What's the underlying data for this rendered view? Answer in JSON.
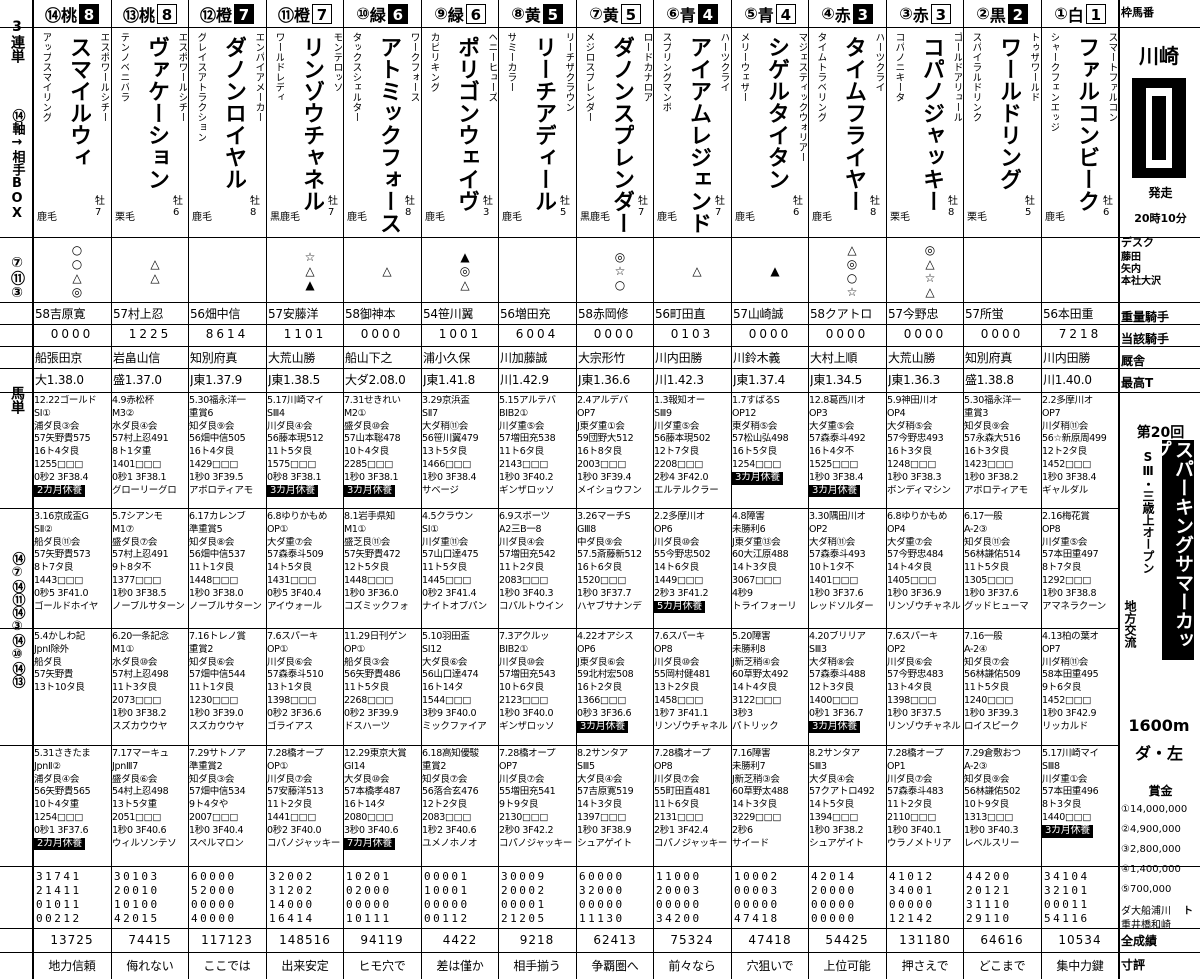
{
  "left_column": {
    "top_label": "3連単",
    "axis": "⑭軸→相手BOX",
    "nums1": [
      "⑦",
      "⑪",
      "③"
    ],
    "grid_nums": [
      "④",
      "⑦",
      "⑩",
      "⑬"
    ],
    "umatan": "馬単",
    "nums2": [
      "⑭",
      "⑦",
      "⑭",
      "⑪",
      "⑭",
      "③",
      "⑭",
      "⑩",
      "⑭",
      "⑬"
    ]
  },
  "race": {
    "venue": "川崎",
    "start_label": "発走",
    "start_time": "20時10分",
    "desk_label": "デスク",
    "reporters": [
      "藤田",
      "矢内",
      "本社大沢"
    ],
    "row_labels": [
      "重量騎手",
      "当該騎手",
      "厩舎",
      "最高T"
    ],
    "race_number_title": "第20回",
    "race_title": "スパーキングサマーカップ",
    "race_sub": "SⅢ・三歳上オープン",
    "race_type": "地方交流",
    "distance": "1600m",
    "course": "ダ・左",
    "prize_label": "賞金",
    "prizes": [
      "①14,000,000",
      "②4,900,000",
      "③2,800,000",
      "④1,400,000",
      "⑤700,000"
    ],
    "bottom_labels": [
      "ダ大船浦川",
      "重井橋和崎",
      "全成績",
      "寸評"
    ],
    "header_label": "枠馬番",
    "trainers_label": "ト"
  },
  "horses": [
    {
      "num": "①",
      "waku": "1",
      "color": "白",
      "name": "ファルコンビーク",
      "sire": "スマートファルコン",
      "dam": "シャークフェンエッジ",
      "sex": "牡6",
      "coat": "鹿毛",
      "marks": "",
      "weight_jockey": "56本田重",
      "jockey_count": "7218",
      "stable": "川内田勝",
      "best_time": "川1.40.0",
      "races": [
        [
          "2.2多摩川オ",
          "OP7",
          "川ダ稍⑪会",
          "56☆新原周499",
          "12ト2タ良",
          "1452□□□",
          "1秒0 3F38.4",
          "ギャルダル"
        ],
        [
          "2.16梅花賞",
          "OP8",
          "川ダ重⑤会",
          "57本田重497",
          "8ト7タ良",
          "1292□□□",
          "1秒0 3F38.8",
          "アマネラクーン"
        ],
        [
          "4.13柏の葉オ",
          "OP7",
          "川ダ稍⑪会",
          "58本田重495",
          "9ト6タ良",
          "1452□□□",
          "1秒0 3F42.9",
          "リッカルド"
        ],
        [
          "5.17川崎マイ",
          "SⅢ8",
          "川ダ重①会",
          "57本田重496",
          "8ト3タ良",
          "1440□□□",
          "3カ月休養",
          ""
        ]
      ],
      "stats": [
        "34104",
        "32101",
        "00011",
        "54116"
      ],
      "total": "10534",
      "comment": "集中力鍵",
      "tag": "3カ月休養"
    },
    {
      "num": "②",
      "waku": "2",
      "color": "黒",
      "name": "ワールドリング",
      "sire": "トゥザワールド",
      "dam": "スパイラルドリンク",
      "sex": "牡5",
      "coat": "栗毛",
      "marks": "",
      "weight_jockey": "57所蛍",
      "jockey_count": "0000",
      "stable": "知別府真",
      "best_time": "盛1.38.8",
      "races": [
        [
          "5.30福永洋一",
          "重賞3",
          "知ダ良⑨会",
          "57永森大516",
          "16ト3タ良",
          "1423□□□",
          "1秒0 3F38.2",
          "アポロティアモ"
        ],
        [
          "6.17一般",
          "A-2③",
          "知ダ良⑪会",
          "56林謙佑514",
          "11ト5タ良",
          "1305□□□",
          "1秒0 3F37.6",
          "グッドヒューマ"
        ],
        [
          "7.16一般",
          "A-2④",
          "知ダ良⑦会",
          "56林謙佑509",
          "11ト5タ良",
          "1240□□□",
          "1秒0 3F39.3",
          "ロイスピーク"
        ],
        [
          "7.29倉敷おつ",
          "A-2③",
          "知ダ良⑨会",
          "56林謙佑502",
          "10ト9タ良",
          "1313□□□",
          "1秒0 3F40.3",
          "レベルスリー"
        ]
      ],
      "stats": [
        "44200",
        "20121",
        "31110",
        "29110"
      ],
      "total": "64616",
      "comment": "どこまで",
      "tag": ""
    },
    {
      "num": "③",
      "waku": "3",
      "color": "赤",
      "name": "コパノジャッキー",
      "sire": "ゴールドアリュール",
      "dam": "コパノニキータ",
      "sex": "牡8",
      "coat": "栗毛",
      "marks": "◎△☆△",
      "weight_jockey": "57今野忠",
      "jockey_count": "0000",
      "stable": "大荒山勝",
      "best_time": "J東1.36.3",
      "races": [
        [
          "5.9神田川オ",
          "OP4",
          "大ダ稍⑤会",
          "57今野忠493",
          "16ト3タ良",
          "1248□□□",
          "1秒0 3F38.3",
          "ボンディマシン"
        ],
        [
          "6.8ゆりかもめ",
          "OP4",
          "大ダ重⑦会",
          "57今野忠484",
          "14ト4タ良",
          "1405□□□",
          "1秒0 3F36.9",
          "リンゾウチャネル"
        ],
        [
          "7.6スパーキ",
          "OP2",
          "川ダ良⑥会",
          "57今野忠483",
          "13ト4タ良",
          "1398□□□",
          "1秒0 3F37.5",
          "リンゾウチャネル"
        ],
        [
          "7.28橋オープ",
          "OP1",
          "川ダ良⑦会",
          "57森泰斗483",
          "11ト2タ良",
          "2110□□□",
          "1秒0 3F40.1",
          "ウラノメトリア"
        ]
      ],
      "stats": [
        "41012",
        "34001",
        "00000",
        "12142"
      ],
      "total": "131180",
      "comment": "押さえで",
      "tag": ""
    },
    {
      "num": "④",
      "waku": "3",
      "color": "赤",
      "name": "タイムフライヤー",
      "sire": "ハーツクライ",
      "dam": "タイムトラベリング",
      "sex": "牡8",
      "coat": "鹿毛",
      "marks": "△◎○☆",
      "weight_jockey": "58クアトロ",
      "jockey_count": "0000",
      "stable": "大村上順",
      "best_time": "J東1.34.5",
      "races": [
        [
          "12.8葛西川オ",
          "OP3",
          "大ダ重⑤会",
          "57森泰斗492",
          "16ト4タ不",
          "1525□□□",
          "1秒0 3F38.4",
          "3カ月休養"
        ],
        [
          "3.30隅田川オ",
          "OP2",
          "大ダ稍⑪会",
          "57森泰斗493",
          "10ト1タ不",
          "1401□□□",
          "1秒0 3F37.6",
          "レッドソルダー"
        ],
        [
          "4.20ブリリア",
          "SⅢ3",
          "大ダ稍⑧会",
          "57森泰斗488",
          "12ト3タ良",
          "1400□□□",
          "0秒1 3F36.7",
          "3カ月休養"
        ],
        [
          "8.2サンタア",
          "SⅢ3",
          "大ダ良④会",
          "57クアトロ492",
          "14ト5タ良",
          "1394□□□",
          "1秒0 3F38.2",
          "シュアゲイト"
        ]
      ],
      "stats": [
        "42014",
        "20000",
        "00000",
        "00000"
      ],
      "total": "54425",
      "comment": "上位可能",
      "tag": ""
    },
    {
      "num": "⑤",
      "waku": "4",
      "color": "青",
      "name": "シゲルタイタン",
      "sire": "マジェスティックウォリアー",
      "dam": "メリーウェザー",
      "sex": "牡6",
      "coat": "鹿毛",
      "marks": "▲",
      "weight_jockey": "57山崎誠",
      "jockey_count": "0000",
      "stable": "川鈴木義",
      "best_time": "J東1.37.4",
      "races": [
        [
          "1.7すばるS",
          "OP12",
          "東ダ稍⑤会",
          "57松山弘498",
          "16ト5タ良",
          "1254□□□",
          "3カ月休養",
          ""
        ],
        [
          "4.8障害",
          "未勝利6",
          "J東ダ重⑬会",
          "60大江原488",
          "14ト3タ良",
          "3067□□□",
          "4秒9",
          "トライフォーリ"
        ],
        [
          "5.20障害",
          "未勝利8",
          "J新芝稍④会",
          "60草野太492",
          "14ト4タ良",
          "3122□□□",
          "3秒3",
          "パトリック"
        ],
        [
          "7.16障害",
          "未勝利7",
          "J新芝稍③会",
          "60草野太488",
          "14ト3タ良",
          "3229□□□",
          "2秒6",
          "サイード"
        ]
      ],
      "stats": [
        "10002",
        "00003",
        "00000",
        "47418"
      ],
      "total": "47418",
      "comment": "穴狙いで",
      "tag": "3カ月休養"
    },
    {
      "num": "⑥",
      "waku": "4",
      "color": "青",
      "name": "アイアムレジェンド",
      "sire": "ハーツクライ",
      "dam": "スプリングマンボ",
      "sex": "牡7",
      "coat": "鹿毛",
      "marks": "△",
      "weight_jockey": "56町田直",
      "jockey_count": "0103",
      "stable": "川内田勝",
      "best_time": "川1.42.3",
      "races": [
        [
          "1.3報知オー",
          "SⅢ9",
          "川ダ重⑤会",
          "56藤本現502",
          "12ト7タ良",
          "2208□□□",
          "2秒4 3F42.0",
          "エルテルクラー"
        ],
        [
          "2.2多摩川オ",
          "OP6",
          "川ダ良⑩会",
          "55今野忠502",
          "14ト6タ良",
          "1449□□□",
          "2秒3 3F41.2",
          "5カ月休養"
        ],
        [
          "7.6スパーキ",
          "OP8",
          "川ダ良⑩会",
          "55岡村健481",
          "13ト2タ良",
          "1458□□□",
          "1秒7 3F41.1",
          "リンゾウチャネル"
        ],
        [
          "7.28橋オープ",
          "OP8",
          "川ダ良⑦会",
          "55町田直481",
          "11ト6タ良",
          "2131□□□",
          "2秒1 3F42.4",
          "コパノジャッキー"
        ]
      ],
      "stats": [
        "11000",
        "20003",
        "00000",
        "34200"
      ],
      "total": "75324",
      "comment": "前々なら",
      "tag": "5カ月休養"
    },
    {
      "num": "⑦",
      "waku": "5",
      "color": "黄",
      "name": "ダノンスプレンダー",
      "sire": "ロードカナロア",
      "dam": "メジロスプレンダー",
      "sex": "牡7",
      "coat": "黒鹿毛",
      "marks": "◎☆○",
      "weight_jockey": "58赤岡修",
      "jockey_count": "0000",
      "stable": "大宗形竹",
      "best_time": "J東1.36.6",
      "races": [
        [
          "2.4アルデバ",
          "OP7",
          "J東ダ重①会",
          "59団野大512",
          "16ト8タ良",
          "2003□□□",
          "1秒0 3F39.4",
          "メイショウフン"
        ],
        [
          "3.26マーチS",
          "GⅢ8",
          "中ダ良⑨会",
          "57.5斎藤新512",
          "16ト6タ良",
          "1520□□□",
          "1秒0 3F37.7",
          "ハヤブサナンデ"
        ],
        [
          "4.22オアシス",
          "OP6",
          "J東ダ良⑥会",
          "59北村宏508",
          "16ト2タ良",
          "1366□□□",
          "0秒3 3F36.6",
          "3カ月休養"
        ],
        [
          "8.2サンタア",
          "SⅢ5",
          "大ダ良④会",
          "57吉原寛519",
          "14ト3タ良",
          "1397□□□",
          "1秒0 3F38.9",
          "シュアゲイト"
        ]
      ],
      "stats": [
        "60000",
        "32000",
        "00000",
        "11130"
      ],
      "total": "62413",
      "comment": "争覇圏へ",
      "tag": "3カ月休養"
    },
    {
      "num": "⑧",
      "waku": "5",
      "color": "黄",
      "name": "リーチアディール",
      "sire": "リーチザクラウン",
      "dam": "サミーカラー",
      "sex": "牡5",
      "coat": "鹿毛",
      "marks": "",
      "weight_jockey": "56増田充",
      "jockey_count": "6004",
      "stable": "川加藤誠",
      "best_time": "川1.42.9",
      "races": [
        [
          "5.15アルテバ",
          "BIB2①",
          "川ダ重⑤会",
          "57増田充538",
          "11ト6タ良",
          "2143□□□",
          "1秒0 3F40.2",
          "ギンザロッソ"
        ],
        [
          "6.9スポーツ",
          "A2三B一8",
          "川ダ良④会",
          "57増田充542",
          "11ト2タ良",
          "2083□□□",
          "1秒0 3F40.3",
          "コパルトウイン"
        ],
        [
          "7.3アクルッ",
          "BIB2①",
          "川ダ良⑩会",
          "57増田充543",
          "10ト6タ良",
          "2123□□□",
          "1秒0 3F40.0",
          "ギンザロッソ"
        ],
        [
          "7.28橋オープ",
          "OP7",
          "川ダ良⑦会",
          "55増田充541",
          "9ト9タ良",
          "2130□□□",
          "2秒0 3F42.2",
          "コパノジャッキー"
        ]
      ],
      "stats": [
        "30009",
        "20002",
        "00001",
        "21205"
      ],
      "total": "9218",
      "comment": "相手揃う",
      "tag": ""
    },
    {
      "num": "⑨",
      "waku": "6",
      "color": "緑",
      "name": "ポリゴンウェイヴ",
      "sire": "ヘニーヒューズ",
      "dam": "カピリキング",
      "sex": "牡3",
      "coat": "鹿毛",
      "marks": "▲◎△",
      "weight_jockey": "54笹川翼",
      "jockey_count": "1001",
      "stable": "浦小久保",
      "best_time": "J東1.41.8",
      "races": [
        [
          "3.29京浜盃",
          "SⅡ7",
          "大ダ稍⑪会",
          "56笹川翼479",
          "13ト5タ良",
          "1466□□□",
          "1秒0 3F38.4",
          "サベージ"
        ],
        [
          "4.5クラウン",
          "SⅠ①",
          "川ダ重⑪会",
          "57山口達475",
          "11ト5タ良",
          "1445□□□",
          "0秒2 3F41.4",
          "ナイトオブパン"
        ],
        [
          "5.10羽田盃",
          "SⅠ12",
          "大ダ良⑥会",
          "56山口達474",
          "16ト14タ",
          "1544□□□",
          "3秒9 3F40.0",
          "ミックファイア"
        ],
        [
          "6.18高知優駿",
          "重賞2",
          "知ダ良⑦会",
          "56落合玄476",
          "12ト2タ良",
          "2083□□□",
          "1秒2 3F40.6",
          "ユメノホノオ"
        ]
      ],
      "stats": [
        "00001",
        "10001",
        "00000",
        "00112"
      ],
      "total": "4422",
      "comment": "差は僅か",
      "tag": ""
    },
    {
      "num": "⑩",
      "waku": "6",
      "color": "緑",
      "name": "アトミックフォース",
      "sire": "ワークフォース",
      "dam": "タックスシェルター",
      "sex": "牡8",
      "coat": "鹿毛",
      "marks": "△",
      "weight_jockey": "58御神本",
      "jockey_count": "0000",
      "stable": "船山下之",
      "best_time": "大ダ2.08.0",
      "races": [
        [
          "7.31せきれい",
          "M2①",
          "盛ダ良⑩会",
          "57山本聡478",
          "10ト4タ良",
          "2285□□□",
          "1秒0 3F38.1",
          "3カ月休養"
        ],
        [
          "8.1岩手県知",
          "M1①",
          "盛芝良⑪会",
          "57矢野貴472",
          "12ト5タ良",
          "1448□□□",
          "1秒0 3F36.0",
          "コズミックフォ"
        ],
        [
          "11.29日刊ゲン",
          "OP①",
          "船ダ良③会",
          "56矢野貴486",
          "11ト5タ良",
          "2268□□□",
          "0秒2 3F39.9",
          "ドスハーツ"
        ],
        [
          "12.29東京大賞",
          "GⅠ14",
          "大ダ良⑩会",
          "57本橋孝487",
          "16ト14タ",
          "2080□□□",
          "3秒0 3F40.6",
          "7カ月休養"
        ]
      ],
      "stats": [
        "10201",
        "02000",
        "00000",
        "10111"
      ],
      "total": "94119",
      "comment": "ヒモ穴で",
      "tag": "7カ月休養"
    },
    {
      "num": "⑪",
      "waku": "7",
      "color": "橙",
      "name": "リンゾウチャネル",
      "sire": "モンテロッソ",
      "dam": "ワールドレディ",
      "sex": "牡7",
      "coat": "黒鹿毛",
      "marks": "☆△▲",
      "weight_jockey": "57安藤洋",
      "jockey_count": "1101",
      "stable": "大荒山勝",
      "best_time": "J東1.38.5",
      "races": [
        [
          "5.17川崎マイ",
          "SⅢ4",
          "川ダ良④会",
          "56藤本現512",
          "11ト5タ良",
          "1575□□□",
          "0秒8 3F38.1",
          "3カ月休養"
        ],
        [
          "6.8ゆりかもめ",
          "OP①",
          "大ダ重⑦会",
          "57森泰斗509",
          "14ト5タ良",
          "1431□□□",
          "0秒5 3F40.4",
          "アイウォール"
        ],
        [
          "7.6スパーキ",
          "OP①",
          "川ダ良⑥会",
          "57森泰斗510",
          "13ト1タ良",
          "1398□□□",
          "0秒2 3F36.6",
          "ゴライアス"
        ],
        [
          "7.28橋オープ",
          "OP①",
          "川ダ良⑦会",
          "57安藤洋513",
          "11ト2タ良",
          "1441□□□",
          "0秒2 3F40.0",
          "コパノジャッキー"
        ]
      ],
      "stats": [
        "32002",
        "31202",
        "14000",
        "16414"
      ],
      "total": "148516",
      "comment": "出来安定",
      "tag": "3カ月休養"
    },
    {
      "num": "⑫",
      "waku": "7",
      "color": "橙",
      "name": "ダノンロイヤル",
      "sire": "エンパイアメーカー",
      "dam": "グレイスアトラクション",
      "sex": "牡8",
      "coat": "鹿毛",
      "marks": "",
      "weight_jockey": "56畑中信",
      "jockey_count": "8614",
      "stable": "知別府真",
      "best_time": "J東1.37.9",
      "races": [
        [
          "5.30福永洋一",
          "重賞6",
          "知ダ良⑨会",
          "56畑中信505",
          "16ト4タ良",
          "1429□□□",
          "1秒0 3F39.5",
          "アポロティアモ"
        ],
        [
          "6.17カレンブ",
          "準重賞5",
          "知ダ良⑧会",
          "56畑中信537",
          "11ト1タ良",
          "1448□□□",
          "1秒0 3F38.0",
          "ノーブルサターン"
        ],
        [
          "7.16トレノ賞",
          "重賞2",
          "知ダ良⑥会",
          "57畑中信544",
          "11ト1タ良",
          "1230□□□",
          "1秒0 3F39.0",
          "スズカウウヤ"
        ],
        [
          "7.29サトノア",
          "準重賞2",
          "知ダ良③会",
          "57畑中信534",
          "9ト4タや",
          "2007□□□",
          "1秒0 3F40.4",
          "スペルマロン"
        ]
      ],
      "stats": [
        "60000",
        "52000",
        "00000",
        "40000"
      ],
      "total": "117123",
      "comment": "ここでは",
      "tag": ""
    },
    {
      "num": "⑬",
      "waku": "8",
      "color": "桃",
      "name": "ヴァケーション",
      "sire": "エスポワールシチー",
      "dam": "テンノベニバラ",
      "sex": "牡6",
      "coat": "栗毛",
      "marks": "△△",
      "weight_jockey": "57村上忍",
      "jockey_count": "1225",
      "stable": "岩畠山信",
      "best_time": "盛1.37.0",
      "races": [
        [
          "4.9赤松杯",
          "M3②",
          "水ダ良④会",
          "57村上忍491",
          "8ト1タ重",
          "1401□□□",
          "0秒1 3F38.1",
          "グローリーグロ"
        ],
        [
          "5.7シアンモ",
          "M1⑦",
          "盛ダ良⑦会",
          "57村上忍491",
          "9ト8タ不",
          "1377□□□",
          "1秒0 3F38.5",
          "ノーブルサターン"
        ],
        [
          "6.20一条記念",
          "M1①",
          "水ダ良⑩会",
          "57村上忍498",
          "11ト3タ良",
          "2073□□□",
          "1秒0 3F38.2",
          "スズカウウヤ"
        ],
        [
          "7.17マーキュ",
          "JpnⅢ7",
          "盛ダ良⑥会",
          "54村上忍498",
          "13ト5タ重",
          "2051□□□",
          "1秒0 3F40.6",
          "ウィルソンテソ"
        ]
      ],
      "stats": [
        "30103",
        "20010",
        "10100",
        "42015"
      ],
      "total": "74415",
      "comment": "侮れない",
      "tag": ""
    },
    {
      "num": "⑭",
      "waku": "8",
      "color": "桃",
      "name": "スマイルウィ",
      "sire": "エスポワールシチー",
      "dam": "アップスマイリング",
      "sex": "牡7",
      "coat": "鹿毛",
      "marks": "○○△◎",
      "weight_jockey": "58吉原寛",
      "jockey_count": "0000",
      "stable": "船張田京",
      "best_time": "大1.38.0",
      "races": [
        [
          "12.22ゴールド",
          "SⅠ①",
          "浦ダ良③会",
          "57矢野貴575",
          "16ト4タ良",
          "1255□□□",
          "0秒2 3F38.4",
          "2カ月休養"
        ],
        [
          "3.16京成盃G",
          "SⅡ②",
          "船ダ良⑪会",
          "57矢野貴573",
          "8ト7タ良",
          "1443□□□",
          "0秒5 3F41.0",
          "ゴールドホイヤ"
        ],
        [
          "5.4かしわ記",
          "JpnⅠ除外",
          "船ダ良",
          "57矢野貴",
          "13ト10タ良",
          "",
          "",
          ""
        ],
        [
          "5.31さきたま",
          "JpnⅡ②",
          "浦ダ良④会",
          "56矢野貴565",
          "10ト4タ重",
          "1254□□□",
          "0秒1 3F37.6",
          "2カ月休養"
        ]
      ],
      "stats": [
        "31741",
        "21411",
        "01011",
        "00212"
      ],
      "total": "13725",
      "comment": "地力信頼",
      "tag": "2カ月休養"
    }
  ]
}
